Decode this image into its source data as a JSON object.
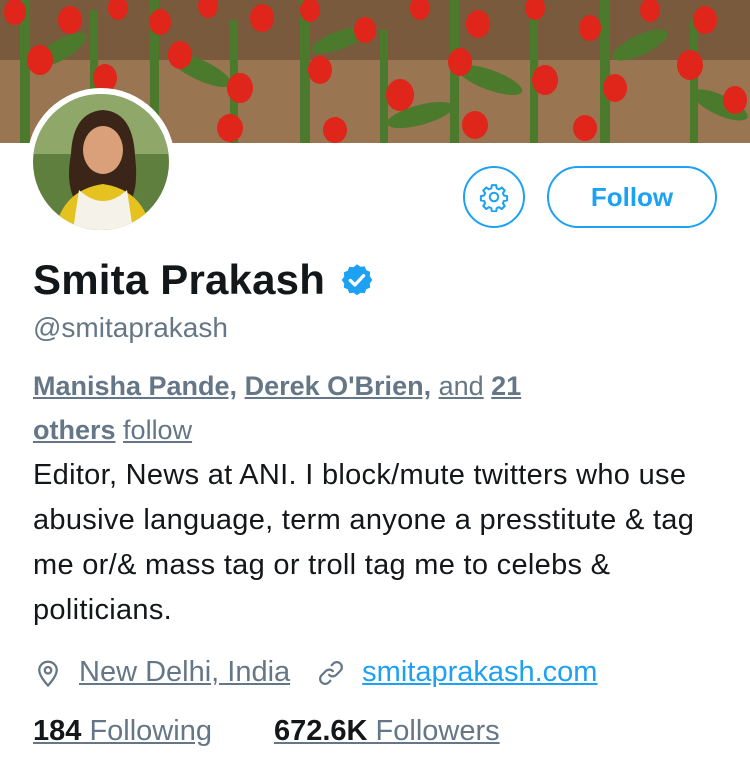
{
  "profile": {
    "name": "Smita Prakash",
    "handle": "@smitaprakash",
    "verified": true,
    "follow_label": "Follow",
    "followed_by": {
      "user1": "Manisha Pande,",
      "user2": "Derek O'Brien,",
      "and": "and",
      "count": "21",
      "others": "others",
      "follow": "follow"
    },
    "bio": "Editor, News at ANI. I block/mute twitters who use abusive language, term anyone a presstitute & tag me or/& mass tag or troll tag me to celebs & politicians.",
    "location": "New Delhi, India",
    "website": "smitaprakash.com",
    "following_count": "184",
    "following_label": "Following",
    "followers_count": "672.6K",
    "followers_label": "Followers"
  },
  "icons": {
    "settings": "gear-icon",
    "verified": "verified-badge-icon",
    "location": "location-pin-icon",
    "website": "link-icon"
  },
  "colors": {
    "accent": "#1da1f2",
    "secondary_text": "#657786",
    "primary_text": "#14171a"
  }
}
